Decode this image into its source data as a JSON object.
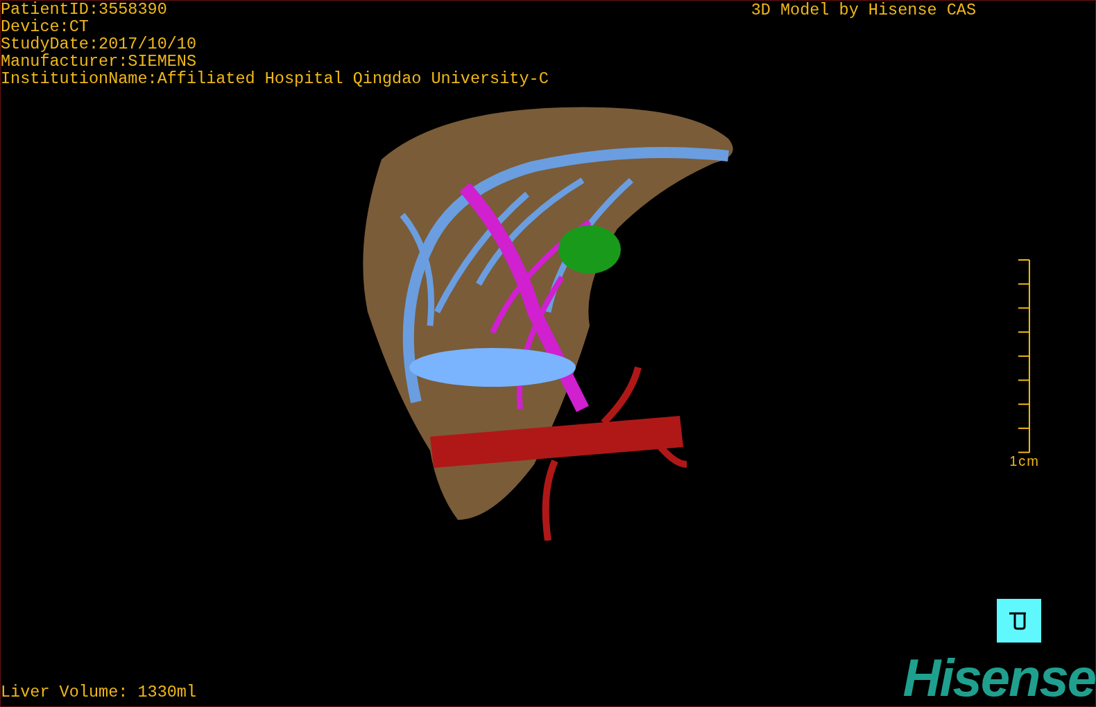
{
  "info_lines": [
    "PatientID:3558390",
    "Device:CT",
    "StudyDate:2017/10/10",
    "Manufacturer:SIEMENS",
    "InstitutionName:Affiliated Hospital Qingdao University-C"
  ],
  "title": "3D Model by Hisense CAS",
  "scale_bar": {
    "label": "1cm"
  },
  "liver_volume": "Liver Volume: 1330ml",
  "logo": "Hisense"
}
